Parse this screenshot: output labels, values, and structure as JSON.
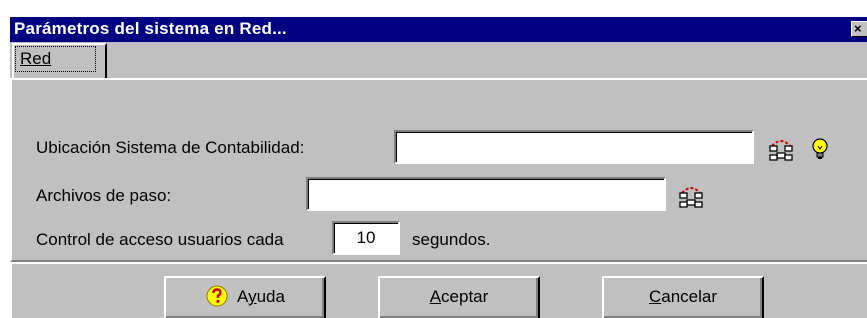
{
  "window": {
    "title": "Parámetros del sistema en Red...",
    "close_glyph": "×"
  },
  "tabs": [
    {
      "label": "Red"
    }
  ],
  "form": {
    "ubicacion_label": "Ubicación Sistema de Contabilidad:",
    "ubicacion_value": "",
    "archivos_label": "Archivos de paso:",
    "archivos_value": "",
    "control_label": "Control de acceso usuarios cada",
    "control_value": "10",
    "control_suffix": "segundos."
  },
  "buttons": {
    "help": {
      "label": "Ayuda",
      "icon": "help-icon"
    },
    "ok": {
      "label": "Aceptar"
    },
    "cancel": {
      "label": "Cancelar"
    }
  },
  "icons": {
    "network": "network-browse-icon",
    "bulb": "lightbulb-icon"
  }
}
